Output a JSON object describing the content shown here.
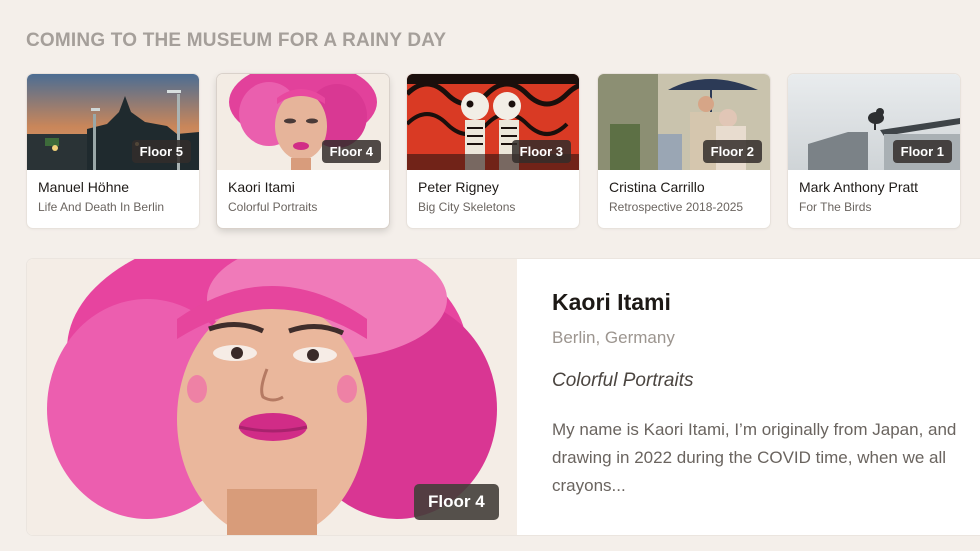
{
  "section_heading": "COMING TO THE MUSEUM FOR A RAINY DAY",
  "cards": [
    {
      "name": "Manuel Höhne",
      "series": "Life And Death In Berlin",
      "floor": "Floor 5"
    },
    {
      "name": "Kaori Itami",
      "series": "Colorful Portraits",
      "floor": "Floor 4"
    },
    {
      "name": "Peter Rigney",
      "series": "Big City Skeletons",
      "floor": "Floor 3"
    },
    {
      "name": "Cristina Carrillo",
      "series": "Retrospective 2018-2025",
      "floor": "Floor 2"
    },
    {
      "name": "Mark Anthony Pratt",
      "series": "For The Birds",
      "floor": "Floor 1"
    }
  ],
  "selected_index": 1,
  "detail": {
    "name": "Kaori Itami",
    "location": "Berlin, Germany",
    "series": "Colorful Portraits",
    "bio_line1": "My name is Kaori Itami, I’m originally from Japan, and",
    "bio_line2": "drawing in 2022 during the COVID time, when we all",
    "bio_line3": "crayons...",
    "floor": "Floor 4"
  },
  "colors": {
    "background": "#f4efea",
    "heading": "#a59f9a",
    "badge": "#322d2a"
  }
}
